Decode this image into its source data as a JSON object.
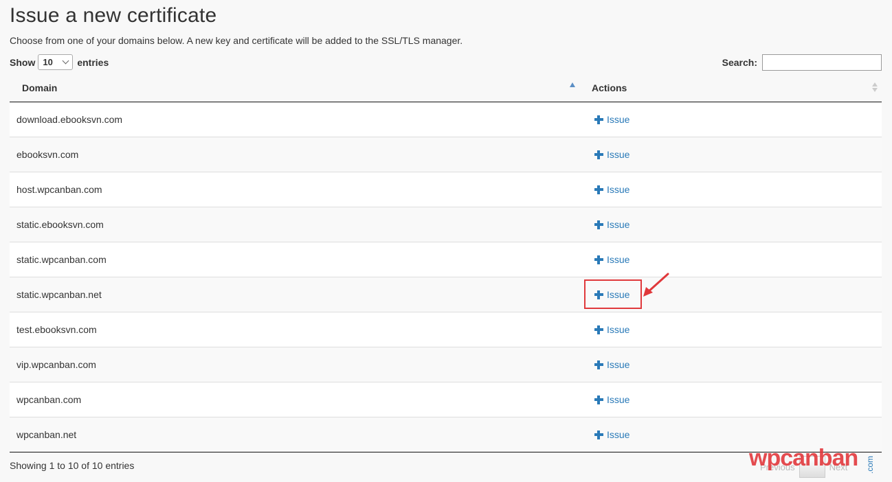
{
  "page": {
    "title": "Issue a new certificate",
    "description": "Choose from one of your domains below. A new key and certificate will be added to the SSL/TLS manager."
  },
  "controls": {
    "show_label": "Show",
    "entries_value": "10",
    "entries_label": "entries",
    "search_label": "Search:",
    "search_value": ""
  },
  "table": {
    "columns": [
      "Domain",
      "Actions"
    ],
    "rows": [
      {
        "domain": "download.ebooksvn.com",
        "action": "Issue"
      },
      {
        "domain": "ebooksvn.com",
        "action": "Issue"
      },
      {
        "domain": "host.wpcanban.com",
        "action": "Issue"
      },
      {
        "domain": "static.ebooksvn.com",
        "action": "Issue"
      },
      {
        "domain": "static.wpcanban.com",
        "action": "Issue"
      },
      {
        "domain": "static.wpcanban.net",
        "action": "Issue"
      },
      {
        "domain": "test.ebooksvn.com",
        "action": "Issue"
      },
      {
        "domain": "vip.wpcanban.com",
        "action": "Issue"
      },
      {
        "domain": "wpcanban.com",
        "action": "Issue"
      },
      {
        "domain": "wpcanban.net",
        "action": "Issue"
      }
    ]
  },
  "footer": {
    "info": "Showing 1 to 10 of 10 entries",
    "previous": "Previous",
    "next": "Next"
  },
  "watermark": {
    "text": "wpcanban",
    "suffix": ".com"
  },
  "colors": {
    "link": "#2a7ab8",
    "highlight": "#e0383b"
  }
}
